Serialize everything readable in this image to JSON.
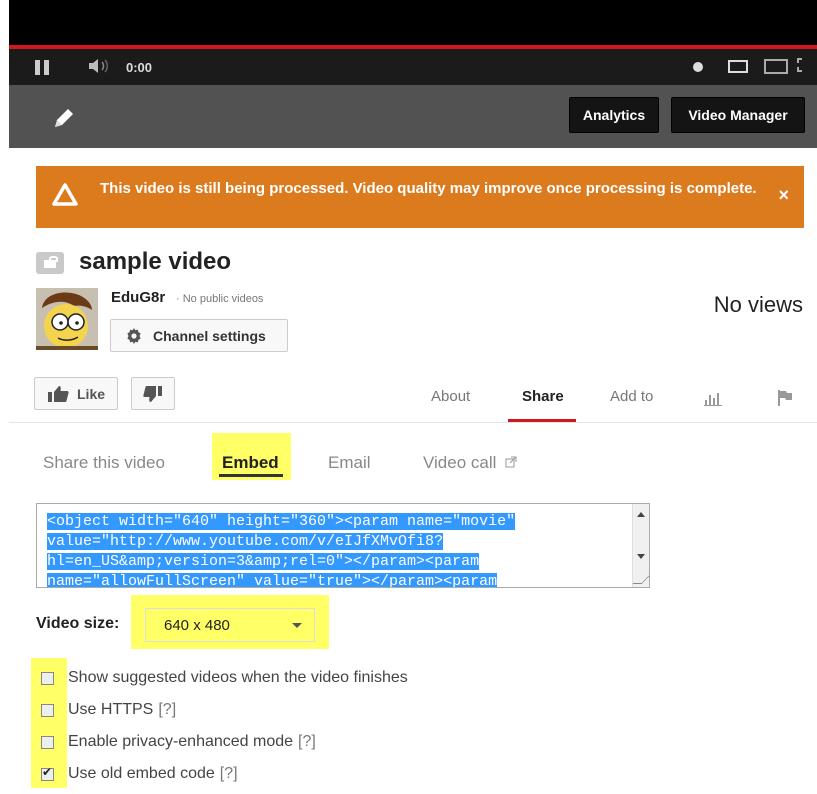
{
  "player": {
    "time": "0:00"
  },
  "owner_bar": {
    "analytics_label": "Analytics",
    "video_manager_label": "Video Manager"
  },
  "notice": {
    "text": "This video is still being processed. Video quality may improve once processing is complete.",
    "close_label": "×"
  },
  "video": {
    "title": "sample video",
    "channel_name": "EduG8r",
    "channel_meta": "· No public videos",
    "channel_settings_label": "Channel settings",
    "views": "No views",
    "like_label": "Like"
  },
  "tabs": [
    {
      "label": "About"
    },
    {
      "label": "Share"
    },
    {
      "label": "Add to"
    }
  ],
  "share": {
    "subtabs": [
      {
        "label": "Share this video"
      },
      {
        "label": "Embed"
      },
      {
        "label": "Email"
      },
      {
        "label": "Video call"
      }
    ],
    "embed_code_lines": [
      "<object width=\"640\" height=\"360\"><param name=\"movie\"",
      "value=\"http://www.youtube.com/v/eIJfXMvOfi8?",
      "hl=en_US&amp;version=3&amp;rel=0\"></param><param",
      "name=\"allowFullScreen\" value=\"true\"></param><param"
    ],
    "video_size_label": "Video size:",
    "video_size_value": "640 x 480",
    "options": [
      {
        "label": "Show suggested videos when the video finishes",
        "help": "",
        "checked": false
      },
      {
        "label": "Use HTTPS",
        "help": "[?]",
        "checked": false
      },
      {
        "label": "Enable privacy-enhanced mode",
        "help": "[?]",
        "checked": false
      },
      {
        "label": "Use old embed code",
        "help": "[?]",
        "checked": true
      }
    ]
  },
  "colors": {
    "progress": "#cc181e",
    "notice": "#dc7a1e",
    "highlight": "#ffff66",
    "selection": "#3399ff"
  }
}
